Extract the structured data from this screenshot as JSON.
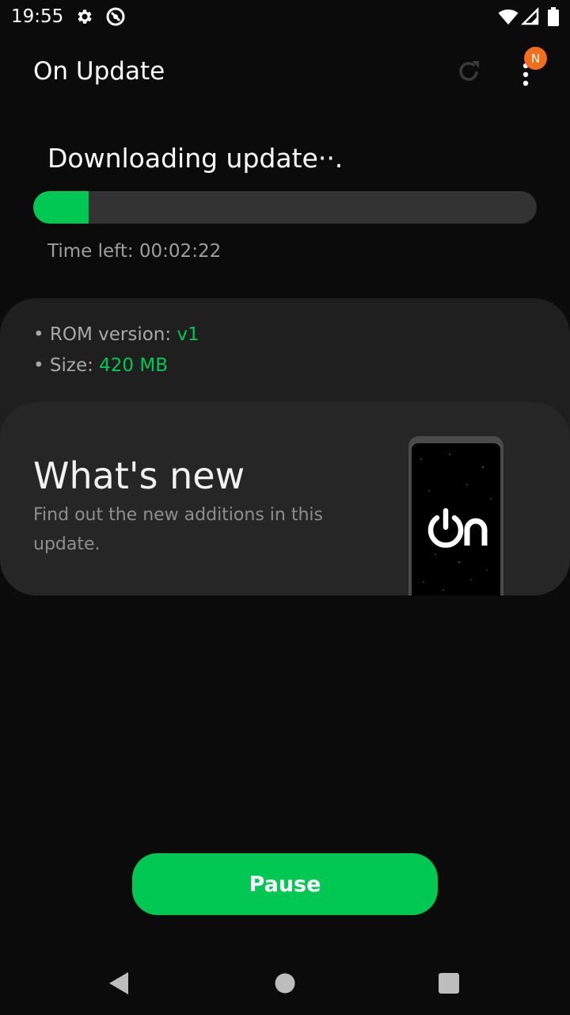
{
  "status_bar": {
    "time": "19:55",
    "icons": [
      "gear-icon",
      "do-not-disturb-icon",
      "wifi-icon",
      "signal-icon",
      "battery-icon"
    ]
  },
  "app_bar": {
    "title": "On Update",
    "actions": [
      "refresh-icon",
      "more-vert-icon"
    ],
    "notification_badge": "N"
  },
  "download": {
    "status": "Downloading update··.",
    "progress_fraction": 0.11,
    "time_left": "Time left: 00:02:22"
  },
  "info": {
    "rom_label": "• ROM version: ",
    "rom_value": "v1",
    "size_label": "• Size: ",
    "size_value": "420 MB"
  },
  "whats_new": {
    "title": "What's new",
    "description": "Find out the new additions in this update.",
    "logo_text": "On"
  },
  "actions": {
    "pause_label": "Pause"
  },
  "nav_bar": [
    "back-icon",
    "home-icon",
    "recents-icon"
  ],
  "colors": {
    "accent": "#00c853",
    "background": "#0b0b0b",
    "card": "#262626",
    "badge": "#f26e1d"
  }
}
